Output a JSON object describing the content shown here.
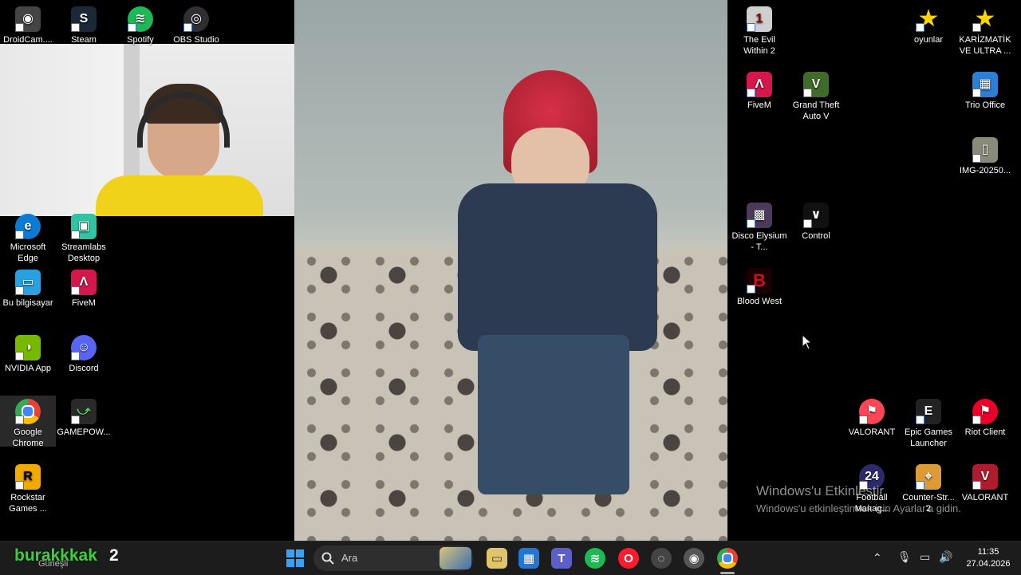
{
  "desktop_icons_left": [
    {
      "label": "DroidCam....",
      "glyph": "◉",
      "bg": "#444"
    },
    {
      "label": "Steam",
      "glyph": "S",
      "bg": "#1b2838"
    },
    {
      "label": "Spotify",
      "glyph": "≋",
      "bg": "#1db954"
    },
    {
      "label": "OBS Studio",
      "glyph": "◎",
      "bg": "#302e31"
    },
    {
      "label": "Microsoft Edge",
      "glyph": "e",
      "bg": "#0c7bd3"
    },
    {
      "label": "Streamlabs Desktop",
      "glyph": "▣",
      "bg": "#31c3a2"
    },
    {
      "label": "Bu bilgisayar",
      "glyph": "▭",
      "bg": "#29a0e0"
    },
    {
      "label": "FiveM",
      "glyph": "Λ",
      "bg": "#d4184c"
    },
    {
      "label": "NVIDIA App",
      "glyph": "◑",
      "bg": "#76b900"
    },
    {
      "label": "Discord",
      "glyph": "☺",
      "bg": "#5865f2"
    },
    {
      "label": "Google Chrome",
      "glyph": "◍",
      "bg": "#e94235"
    },
    {
      "label": "GAMEPOW...",
      "glyph": "⤻",
      "bg": "#2a2a2a"
    },
    {
      "label": "Rockstar Games ...",
      "glyph": "R",
      "bg": "#f2a900"
    }
  ],
  "desktop_icons_right": [
    {
      "label": "The Evil Within 2",
      "glyph": "1",
      "bg": "#cfcfcf"
    },
    {
      "label": "oyunlar",
      "glyph": "★",
      "bg": "#ffd400"
    },
    {
      "label": "KARİZMATİK VE ULTRA ...",
      "glyph": "★",
      "bg": "#ffd400"
    },
    {
      "label": "FiveM",
      "glyph": "Λ",
      "bg": "#d4184c"
    },
    {
      "label": "Grand Theft Auto V",
      "glyph": "V",
      "bg": "#3f6b2b"
    },
    {
      "label": "Trio Office",
      "glyph": "▦",
      "bg": "#2d7fd3"
    },
    {
      "label": "IMG-20250...",
      "glyph": "▯",
      "bg": "#8a8a7a"
    },
    {
      "label": "Disco Elysium - T...",
      "glyph": "▩",
      "bg": "#4b3a5a"
    },
    {
      "label": "Control",
      "glyph": "∨",
      "bg": "#111"
    },
    {
      "label": "Blood West",
      "glyph": "B",
      "bg": "#1a0000"
    },
    {
      "label": "VALORANT",
      "glyph": "⚑",
      "bg": "#ff4655"
    },
    {
      "label": "Epic Games Launcher",
      "glyph": "E",
      "bg": "#222"
    },
    {
      "label": "Riot Client",
      "glyph": "⚑",
      "bg": "#eb0029"
    },
    {
      "label": "Football Manag...",
      "glyph": "24",
      "bg": "#2b2b6b"
    },
    {
      "label": "Counter-Str... 2",
      "glyph": "⌖",
      "bg": "#de9b35"
    },
    {
      "label": "VALORANT",
      "glyph": "V",
      "bg": "#b01c2e"
    }
  ],
  "watermark": {
    "title": "Windows'u Etkinleştir",
    "subtitle": "Windows'u etkinleştirmek için Ayarlar'a gidin."
  },
  "overlay": {
    "name": "burakkkak",
    "number": "2"
  },
  "taskbar": {
    "weather_text": "Güneşli",
    "search_placeholder": "Ara",
    "clock_time": "11:35",
    "clock_date": "27.04.2026",
    "apps": [
      {
        "name": "widget-art-icon",
        "glyph": "⛆",
        "bg": "#3b6fb0"
      },
      {
        "name": "file-explorer-icon",
        "glyph": "▭",
        "bg": "#d9d9d9"
      },
      {
        "name": "store-icon",
        "glyph": "▦",
        "bg": "#2477d1"
      },
      {
        "name": "teams-icon",
        "glyph": "T",
        "bg": "#5b5fc7"
      },
      {
        "name": "spotify-icon",
        "glyph": "≋",
        "bg": "#1db954"
      },
      {
        "name": "opera-icon",
        "glyph": "O",
        "bg": "#ff1b2d"
      },
      {
        "name": "xbox-icon",
        "glyph": "◌",
        "bg": "#444"
      },
      {
        "name": "steam-icon",
        "glyph": "◉",
        "bg": "#555"
      },
      {
        "name": "chrome-icon",
        "glyph": "◍",
        "bg": "#e94235"
      }
    ]
  }
}
